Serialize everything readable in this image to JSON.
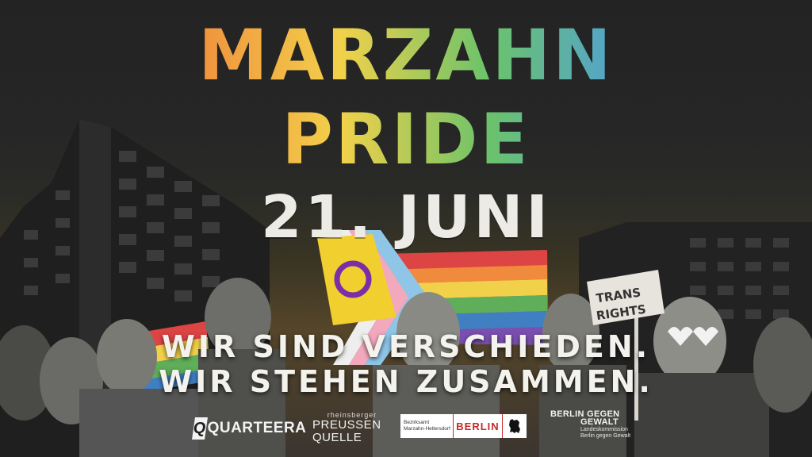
{
  "poster": {
    "title_line1": "MARZAHN",
    "title_line2": "PRIDE",
    "date": "21. JUNI",
    "slogan_line1": "WIR SIND VERSCHIEDEN.",
    "slogan_line2": "WIR STEHEN ZUSAMMEN.",
    "sign_text_line1": "TRANS",
    "sign_text_line2": "RIGHTS",
    "title_gradient": [
      "#e84b4b",
      "#f08a3c",
      "#f2d14a",
      "#6cc36a",
      "#4fa0d8",
      "#9a6ad6"
    ],
    "text_color": "#ecebe6"
  },
  "sponsors": {
    "quarteera": "QUARTEERA",
    "preussen_small": "rheinsberger",
    "preussen_line1": "PREUSSEN",
    "preussen_line2": "QUELLE",
    "bezirksamt_line1": "Bezirksamt",
    "bezirksamt_line2": "Marzahn-Hellersdorf",
    "berlin": "BERLIN",
    "bgg_line1": "BERLIN GEGEN",
    "bgg_line2": "GEWALT",
    "bgg_line3": "Landeskommission",
    "bgg_line4": "Berlin gegen Gewalt",
    "berlin_red": "#c62828"
  },
  "icons": {
    "quarteera_logo": "q-logo-icon",
    "berlin_bear": "berlin-bear-icon",
    "intersex_flag": "intersex-flag-icon",
    "progress_pride_flag": "progress-pride-flag-icon"
  }
}
